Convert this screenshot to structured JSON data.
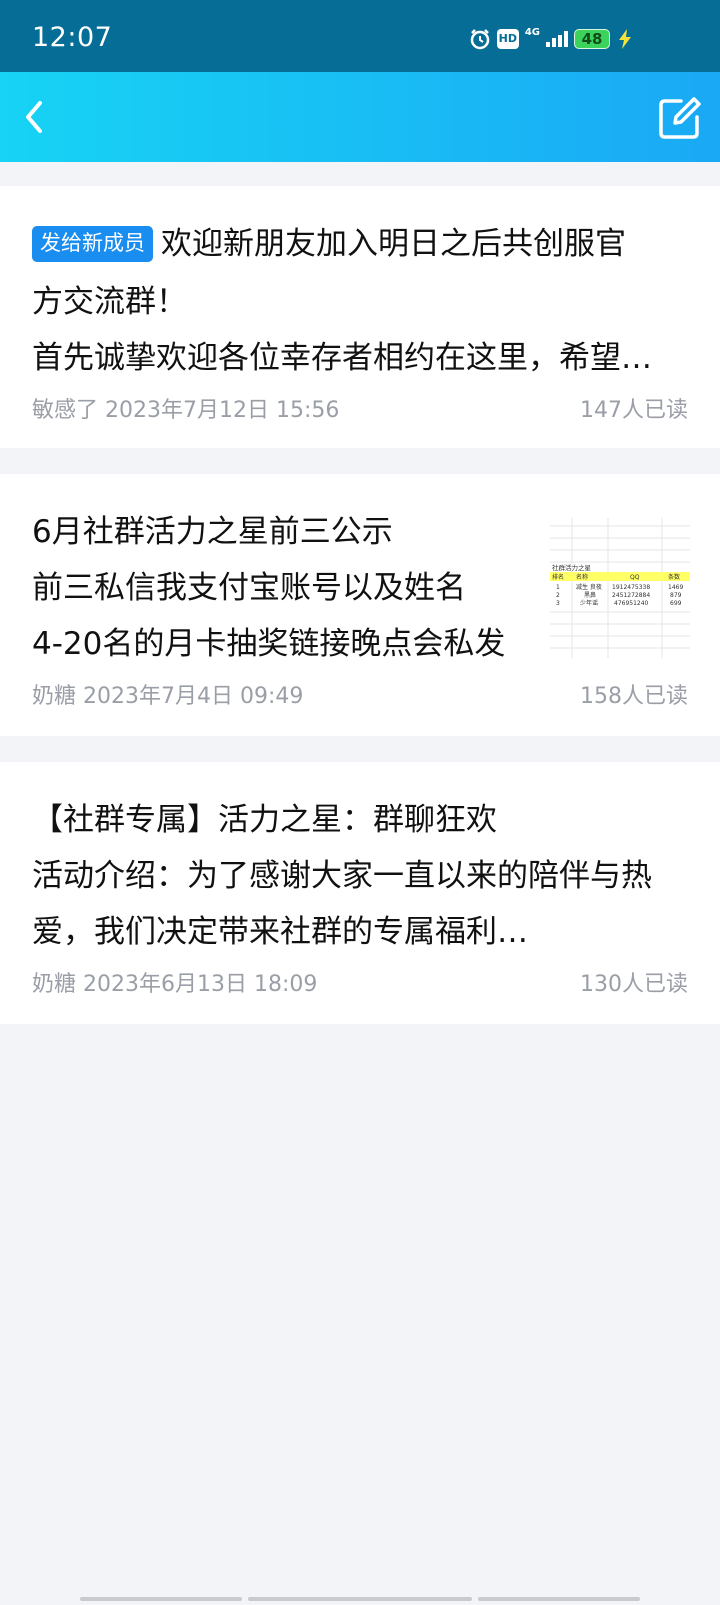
{
  "status_bar": {
    "time": "12:07",
    "hd": "HD",
    "network": "4G",
    "battery": "48",
    "icons": [
      "alarm-icon",
      "signal-icon",
      "charging-icon"
    ]
  },
  "nav": {
    "back_icon": "chevron-left-icon",
    "edit_icon": "edit-icon",
    "gradient_start": "#17d3f4",
    "gradient_end": "#1aa9f5"
  },
  "posts": [
    {
      "tag": "发给新成员",
      "lines": [
        "欢迎新朋友加入明日之后共创服官",
        "方交流群！",
        "首先诚挚欢迎各位幸存者相约在这里，希望…"
      ],
      "author": "敏感了",
      "date": "2023年7月12日 15:56",
      "reads": "147人已读"
    },
    {
      "lines": [
        "6月社群活力之星前三公示",
        "前三私信我支付宝账号以及姓名",
        "4-20名的月卡抽奖链接晚点会私发"
      ],
      "author": "奶糖",
      "date": "2023年7月4日 09:49",
      "reads": "158人已读",
      "thumbnail": {
        "title": "社群活力之星",
        "header": [
          "排名",
          "名称",
          "QQ",
          "条数"
        ],
        "rows": [
          [
            "1",
            "减生 良夜",
            "1912475338",
            "1469"
          ],
          [
            "2",
            "黑鼻",
            "2451272884",
            "879"
          ],
          [
            "3",
            "少年谣",
            "476951240",
            "699"
          ]
        ]
      }
    },
    {
      "lines": [
        "【社群专属】活力之星：群聊狂欢",
        "活动介绍：为了感谢大家一直以来的陪伴与热",
        "爱，我们决定带来社群的专属福利…"
      ],
      "author": "奶糖",
      "date": "2023年6月13日 18:09",
      "reads": "130人已读"
    }
  ],
  "colors": {
    "status_bar": "#066e96",
    "tag_bg": "#1a8df0",
    "page_bg": "#f3f4f8",
    "meta_text": "#9a9ea6"
  }
}
